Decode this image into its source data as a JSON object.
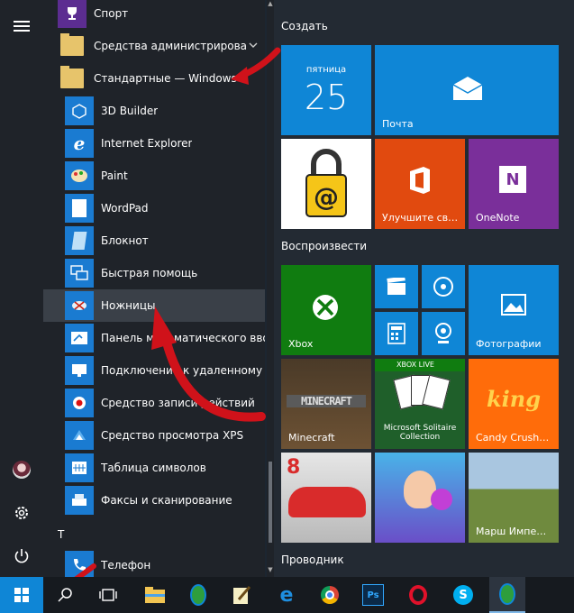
{
  "app_list": {
    "items": [
      {
        "label": "Спорт",
        "icon": "trophy-icon"
      },
      {
        "label": "Средства администрировани…",
        "icon": "folder-icon"
      },
      {
        "label": "Стандартные — Windows",
        "icon": "folder-icon"
      },
      {
        "label": "3D Builder",
        "icon": "3d-builder-icon"
      },
      {
        "label": "Internet Explorer",
        "icon": "internet-explorer-icon"
      },
      {
        "label": "Paint",
        "icon": "paint-icon"
      },
      {
        "label": "WordPad",
        "icon": "wordpad-icon"
      },
      {
        "label": "Блокнот",
        "icon": "notepad-icon"
      },
      {
        "label": "Быстрая помощь",
        "icon": "quick-assist-icon"
      },
      {
        "label": "Ножницы",
        "icon": "snipping-tool-icon"
      },
      {
        "label": "Панель математического ввода",
        "icon": "math-input-icon"
      },
      {
        "label": "Подключение к удаленному ра",
        "icon": "remote-desktop-icon"
      },
      {
        "label": "Средство записи действий",
        "icon": "steps-recorder-icon"
      },
      {
        "label": "Средство просмотра XPS",
        "icon": "xps-viewer-icon"
      },
      {
        "label": "Таблица символов",
        "icon": "character-map-icon"
      },
      {
        "label": "Факсы и сканирование",
        "icon": "fax-scan-icon"
      }
    ],
    "section_letter": "Т",
    "last_item": {
      "label": "Телефон",
      "icon": "phone-icon"
    }
  },
  "groups": {
    "create": "Создать",
    "play": "Воспроизвести",
    "explorer": "Проводник"
  },
  "tiles": {
    "calendar_day": "пятница",
    "calendar_date": "25",
    "mail": "Почта",
    "office": "Улучшите св…",
    "onenote": "OneNote",
    "xbox": "Xbox",
    "photos": "Фотографии",
    "minecraft": "Minecraft",
    "minecraft_logo": "MINECRAFT",
    "xbox_live_badge": "XBOX LIVE",
    "solitaire": "Microsoft Solitaire Collection",
    "candy": "Candy Crush…",
    "candy_logo": "king",
    "march": "Марш Импе…"
  },
  "colors": {
    "accent": "#0078d7",
    "tile_blue": "#0f86d6",
    "office": "#e14a0f",
    "onenote": "#7a2f9a",
    "xbox": "#107c10",
    "candy": "#ff6c0a",
    "arrow": "#d0121a"
  }
}
